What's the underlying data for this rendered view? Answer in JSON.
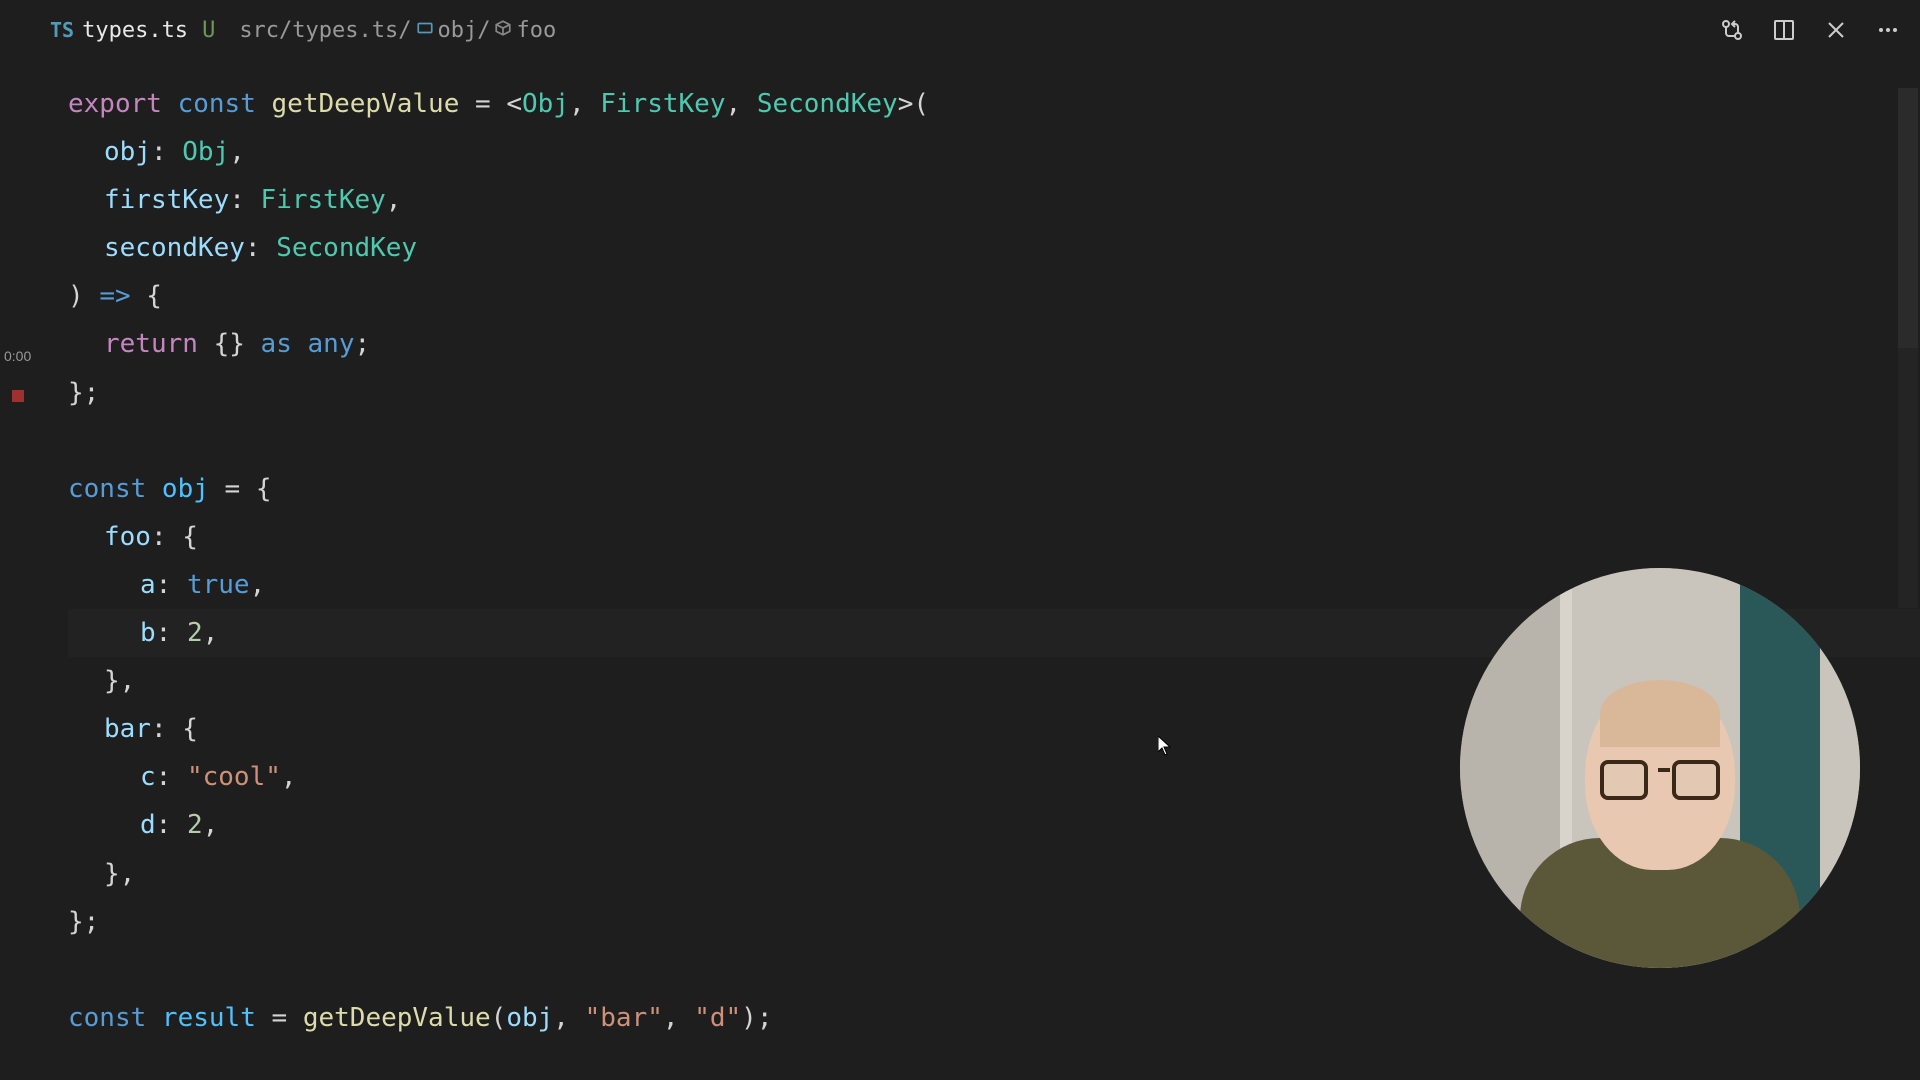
{
  "tab": {
    "icon_label": "TS",
    "filename": "types.ts",
    "status": "U"
  },
  "breadcrumb": {
    "path": "src/types.ts/",
    "symbol1": "obj/",
    "symbol2": "foo"
  },
  "overlay": {
    "time": "0:00"
  },
  "code": {
    "l1": {
      "export": "export",
      "const": "const",
      "fn": "getDeepValue",
      "eq": " = <",
      "t1": "Obj",
      "c1": ", ",
      "t2": "FirstKey",
      "c2": ", ",
      "t3": "SecondKey",
      "end": ">("
    },
    "l2": {
      "param": "obj",
      "colon": ": ",
      "type": "Obj",
      "comma": ","
    },
    "l3": {
      "param": "firstKey",
      "colon": ": ",
      "type": "FirstKey",
      "comma": ","
    },
    "l4": {
      "param": "secondKey",
      "colon": ": ",
      "type": "SecondKey"
    },
    "l5": {
      "close": ") ",
      "arrow": "=>",
      "brace": " {"
    },
    "l6": {
      "return": "return",
      "obj": " {} ",
      "as": "as",
      "any": " any",
      "semi": ";"
    },
    "l7": {
      "close": "};"
    },
    "l9": {
      "const": "const",
      "var": " obj",
      "eq": " = {"
    },
    "l10": {
      "prop": "foo",
      "colon": ": {"
    },
    "l11": {
      "prop": "a",
      "colon": ": ",
      "val": "true",
      "comma": ","
    },
    "l12": {
      "prop": "b",
      "colon": ": ",
      "val": "2",
      "comma": ","
    },
    "l13": {
      "close": "},"
    },
    "l14": {
      "prop": "bar",
      "colon": ": {"
    },
    "l15": {
      "prop": "c",
      "colon": ": ",
      "val": "\"cool\"",
      "comma": ","
    },
    "l16": {
      "prop": "d",
      "colon": ": ",
      "val": "2",
      "comma": ","
    },
    "l17": {
      "close": "},"
    },
    "l18": {
      "close": "};"
    },
    "l20": {
      "const": "const",
      "var": " result",
      "eq": " = ",
      "fn": "getDeepValue",
      "open": "(",
      "arg1": "obj",
      "c1": ", ",
      "arg2": "\"bar\"",
      "c2": ", ",
      "arg3": "\"d\"",
      "close": ");"
    }
  }
}
